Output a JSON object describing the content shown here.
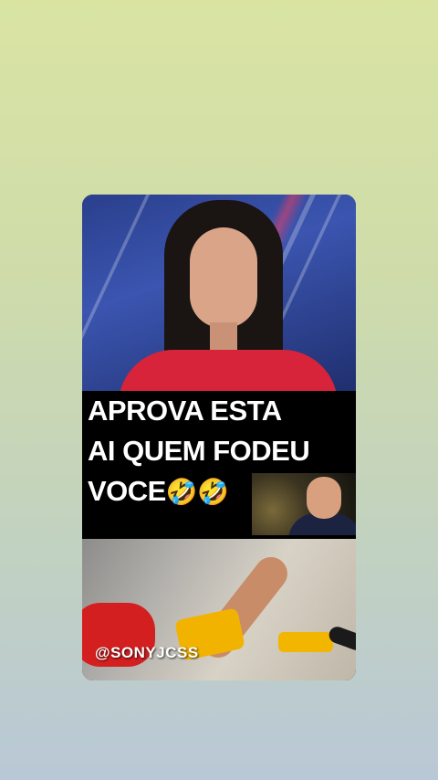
{
  "story": {
    "caption_lines": [
      "APROVA ESTA",
      "AI QUEM FODEU",
      "VOCE"
    ],
    "caption_emoji": "🤣🤣",
    "watermark": "@SONYJCSS"
  },
  "colors": {
    "background_top": "#d9e4a3",
    "background_bottom": "#b9c8d6",
    "caption_bg": "#000000",
    "caption_text": "#ffffff"
  }
}
